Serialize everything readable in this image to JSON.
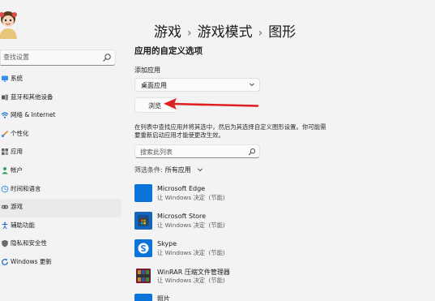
{
  "sidebar": {
    "search_placeholder": "查找设置",
    "items": [
      {
        "label": "系统",
        "icon": "monitor-icon"
      },
      {
        "label": "蓝牙和其他设备",
        "icon": "bluetooth-icon"
      },
      {
        "label": "网络 & Internet",
        "icon": "network-icon"
      },
      {
        "label": "个性化",
        "icon": "brush-icon"
      },
      {
        "label": "应用",
        "icon": "apps-icon"
      },
      {
        "label": "帐户",
        "icon": "person-icon"
      },
      {
        "label": "时间和语言",
        "icon": "globe-clock-icon"
      },
      {
        "label": "游戏",
        "icon": "gamepad-icon",
        "active": true
      },
      {
        "label": "辅助功能",
        "icon": "accessibility-icon"
      },
      {
        "label": "隐私和安全性",
        "icon": "shield-icon"
      },
      {
        "label": "Windows 更新",
        "icon": "windows-update-icon"
      }
    ]
  },
  "breadcrumb": {
    "items": [
      "游戏",
      "游戏模式",
      "图形"
    ],
    "separator": "›"
  },
  "main": {
    "section_title": "应用的自定义选项",
    "add_app_label": "添加应用",
    "app_type_select": "桌面应用",
    "browse_button": "浏览",
    "description_line1": "在列表中查找应用并将其选中，然后为其选择自定义图形设置。你可能需",
    "description_line2": "要重新启动应用才能使更改生效。",
    "list_search_placeholder": "搜索此列表",
    "filter_label": "筛选条件:",
    "filter_value": "所有应用"
  },
  "apps": [
    {
      "name": "Microsoft Edge",
      "status": "让 Windows 决定",
      "mode": "(节能)",
      "icon": "edge-icon",
      "color": "#0a74d9"
    },
    {
      "name": "Microsoft Store",
      "status": "让 Windows 决定",
      "mode": "(节能)",
      "icon": "store-icon",
      "color": "#0a74d9"
    },
    {
      "name": "Skype",
      "status": "让 Windows 决定",
      "mode": "(节能)",
      "icon": "skype-icon",
      "color": "#0a74d9"
    },
    {
      "name": "WinRAR 压缩文件管理器",
      "status": "让 Windows 决定",
      "mode": "(节能)",
      "icon": "winrar-icon",
      "color": "#7a1a2e"
    },
    {
      "name": "照片",
      "icon": "photos-icon",
      "color": "#0a74d9"
    }
  ],
  "colors": {
    "accent": "#0a74d9",
    "arrow": "#e02020",
    "background": "#f3f3f3"
  }
}
